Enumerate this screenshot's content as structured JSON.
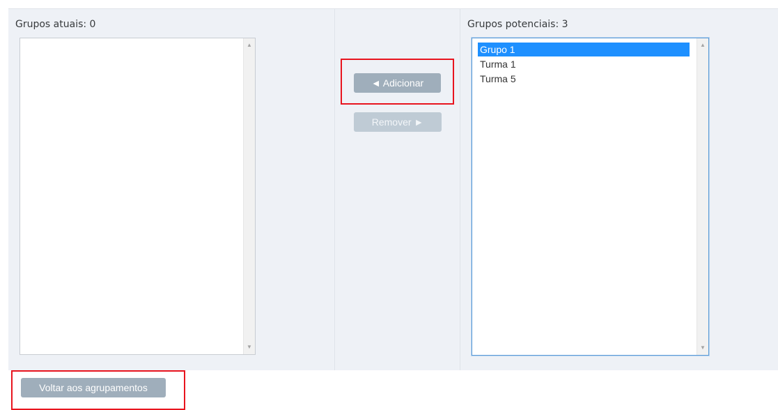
{
  "current_groups": {
    "label": "Grupos atuais: 0",
    "items": []
  },
  "potential_groups": {
    "label": "Grupos potenciais: 3",
    "items": [
      {
        "label": "Grupo 1",
        "selected": true
      },
      {
        "label": "Turma 1",
        "selected": false
      },
      {
        "label": "Turma 5",
        "selected": false
      }
    ]
  },
  "actions": {
    "add_label": "◄ Adicionar",
    "remove_label": "Remover ►",
    "back_label": "Voltar aos agrupamentos"
  },
  "icons": {
    "scroll_up": "triangle-up-icon",
    "scroll_down": "triangle-down-icon"
  },
  "colors": {
    "panel_background": "#eef1f6",
    "button_background": "#9faebb",
    "selection_background": "#1e90ff",
    "highlight_annotation": "#e8141e"
  }
}
